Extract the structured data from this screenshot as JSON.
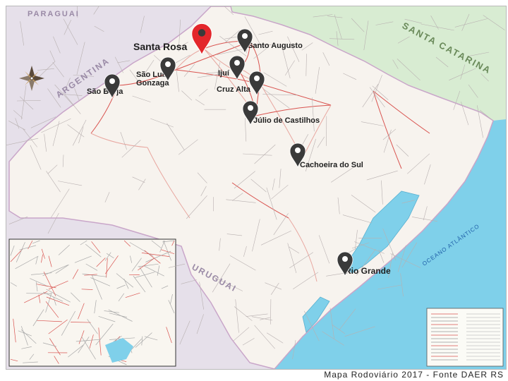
{
  "map": {
    "countries": {
      "paraguay": "PARAGUAI",
      "argentina": "ARGENTINA",
      "uruguay": "URUGUAI"
    },
    "state": "SANTA CATARINA",
    "ocean": "OCEANO ATLÂNTICO",
    "cities": [
      {
        "id": "santa-rosa",
        "name": "Santa Rosa",
        "marker": "red"
      },
      {
        "id": "santo-augusto",
        "name": "Santo Augusto",
        "marker": "dark"
      },
      {
        "id": "sao-luiz-gonzaga",
        "name": "São Luiz Gonzaga",
        "marker": "dark"
      },
      {
        "id": "ijui",
        "name": "Ijuí",
        "marker": "dark"
      },
      {
        "id": "sao-borja",
        "name": "São Borja",
        "marker": "dark"
      },
      {
        "id": "cruz-alta",
        "name": "Cruz Alta",
        "marker": "dark"
      },
      {
        "id": "julio-de-castilhos",
        "name": "Júlio de Castilhos",
        "marker": "dark"
      },
      {
        "id": "cachoeira-do-sul",
        "name": "Cachoeira do Sul",
        "marker": "dark"
      },
      {
        "id": "rio-grande",
        "name": "Rio Grande",
        "marker": "dark"
      }
    ],
    "colors": {
      "marker_red": "#e3262b",
      "marker_dark": "#3a3a3a",
      "land": "#f7f3ee",
      "foreign_land": "#e6e0ea",
      "santa_catarina": "#d8ecd2",
      "sea": "#7fd0ea"
    },
    "icons": [
      "compass-rose-icon",
      "map-pin-icon"
    ]
  },
  "caption": "Mapa Rodoviário 2017 - Fonte DAER RS"
}
